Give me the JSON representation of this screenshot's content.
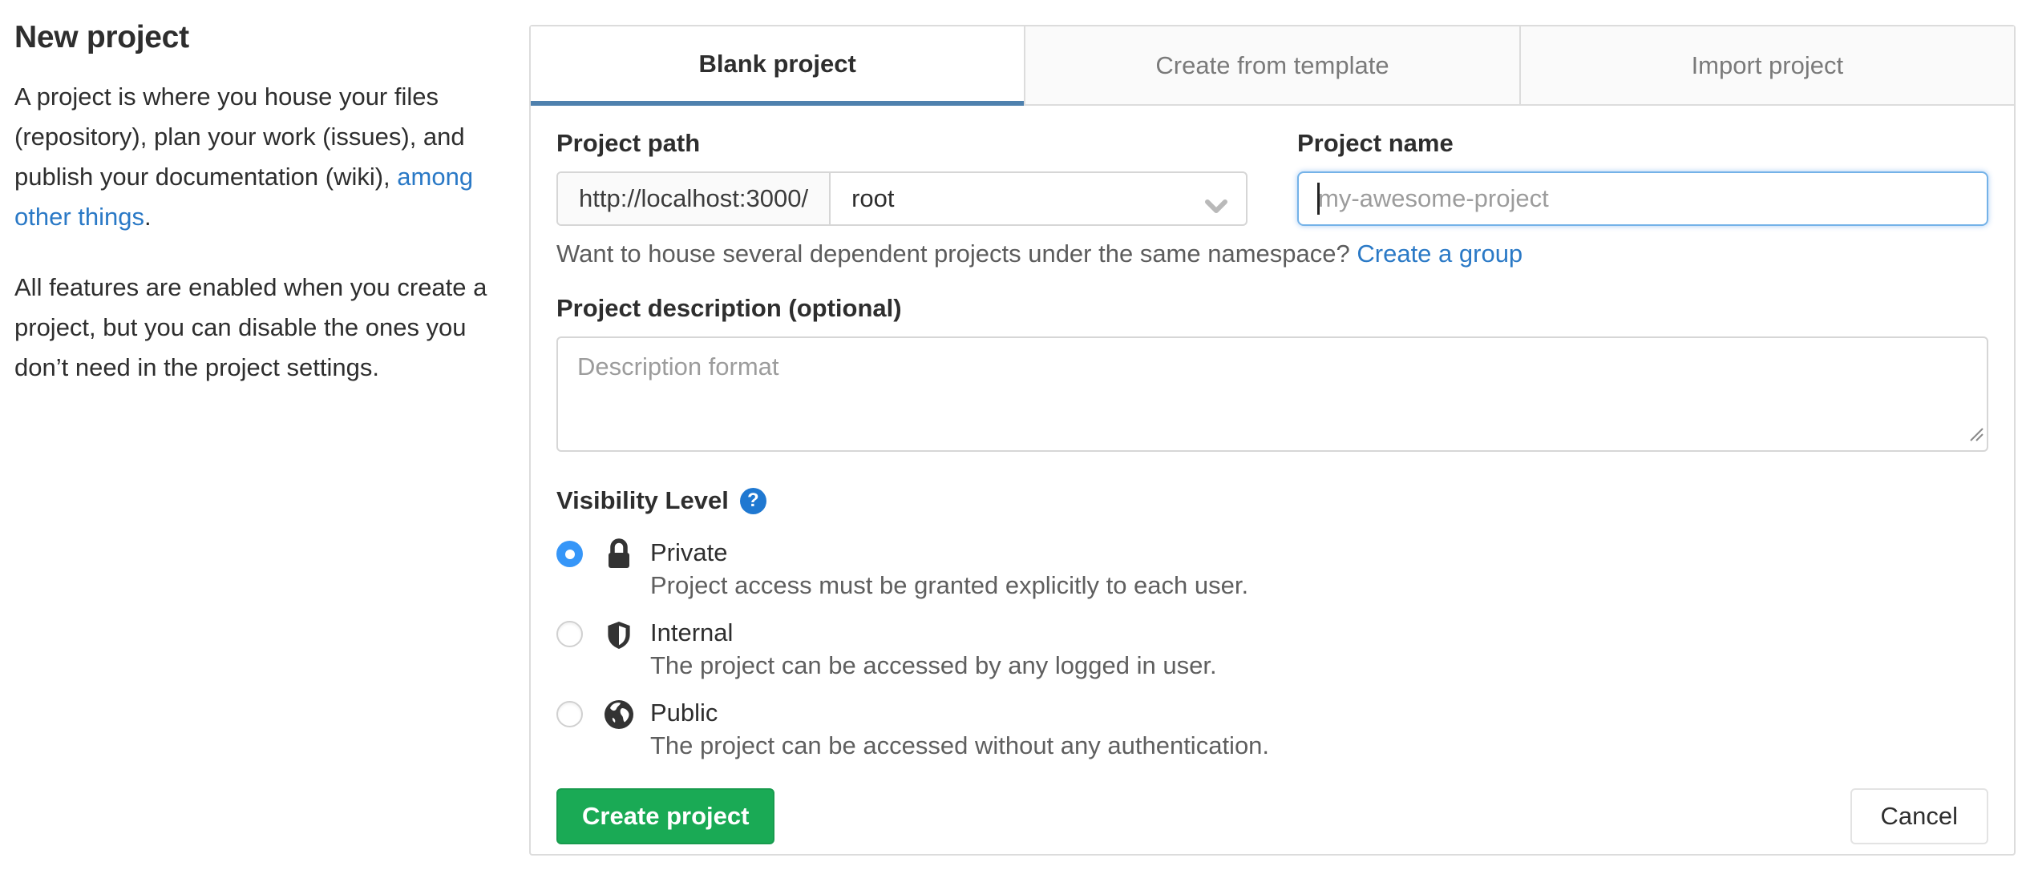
{
  "sidebar": {
    "title": "New project",
    "intro_before_link": "A project is where you house your files (repository), plan your work (issues), and publish your documentation (wiki), ",
    "intro_link": "among other things",
    "intro_after_link": ".",
    "intro_2": "All features are enabled when you create a project, but you can disable the ones you don’t need in the project settings."
  },
  "tabs": [
    {
      "label": "Blank project",
      "active": true
    },
    {
      "label": "Create from template",
      "active": false
    },
    {
      "label": "Import project",
      "active": false
    }
  ],
  "form": {
    "project_path": {
      "label": "Project path",
      "url_prefix": "http://localhost:3000/",
      "namespace_selected": "root",
      "chevron_icon": "chevron-down-icon"
    },
    "project_name": {
      "label": "Project name",
      "placeholder": "my-awesome-project",
      "value": ""
    },
    "namespace_hint": "Want to house several dependent projects under the same namespace?",
    "namespace_link": "Create a group",
    "description": {
      "label": "Project description (optional)",
      "placeholder": "Description format",
      "value": ""
    },
    "visibility": {
      "label": "Visibility Level",
      "help_icon": "question-circle-icon",
      "help_glyph": "?",
      "options": [
        {
          "name": "Private",
          "description": "Project access must be granted explicitly to each user.",
          "icon": "lock-icon",
          "selected": true
        },
        {
          "name": "Internal",
          "description": "The project can be accessed by any logged in user.",
          "icon": "shield-icon",
          "selected": false
        },
        {
          "name": "Public",
          "description": "The project can be accessed without any authentication.",
          "icon": "globe-icon",
          "selected": false
        }
      ]
    },
    "submit_label": "Create project",
    "cancel_label": "Cancel"
  },
  "colors": {
    "link": "#2a79c6",
    "tab_active_underline": "#4f81ae",
    "radio_selected": "#3696f8",
    "help_icon_bg": "#1f78d1",
    "submit_bg": "#1aaa55",
    "text_dark": "#2e2e2e",
    "text_muted": "#5c5c5c",
    "placeholder": "#9c9c9c"
  }
}
